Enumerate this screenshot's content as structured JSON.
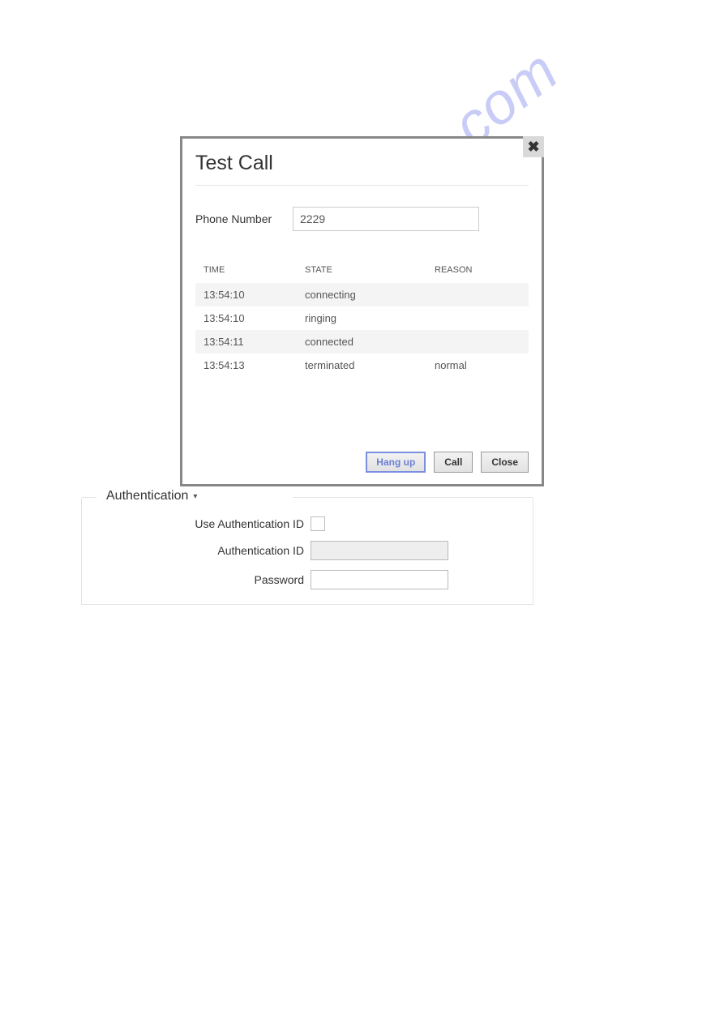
{
  "dialog": {
    "title": "Test Call",
    "phone_label": "Phone Number",
    "phone_value": "2229",
    "columns": {
      "time": "TIME",
      "state": "STATE",
      "reason": "REASON"
    },
    "rows": [
      {
        "time": "13:54:10",
        "state": "connecting",
        "reason": ""
      },
      {
        "time": "13:54:10",
        "state": "ringing",
        "reason": ""
      },
      {
        "time": "13:54:11",
        "state": "connected",
        "reason": ""
      },
      {
        "time": "13:54:13",
        "state": "terminated",
        "reason": "normal"
      }
    ],
    "buttons": {
      "hangup": "Hang up",
      "call": "Call",
      "close": "Close"
    }
  },
  "auth": {
    "header": "Authentication",
    "use_id_label": "Use Authentication ID",
    "id_label": "Authentication ID",
    "password_label": "Password",
    "id_value": "",
    "password_value": ""
  },
  "watermark": "manualshive.com"
}
